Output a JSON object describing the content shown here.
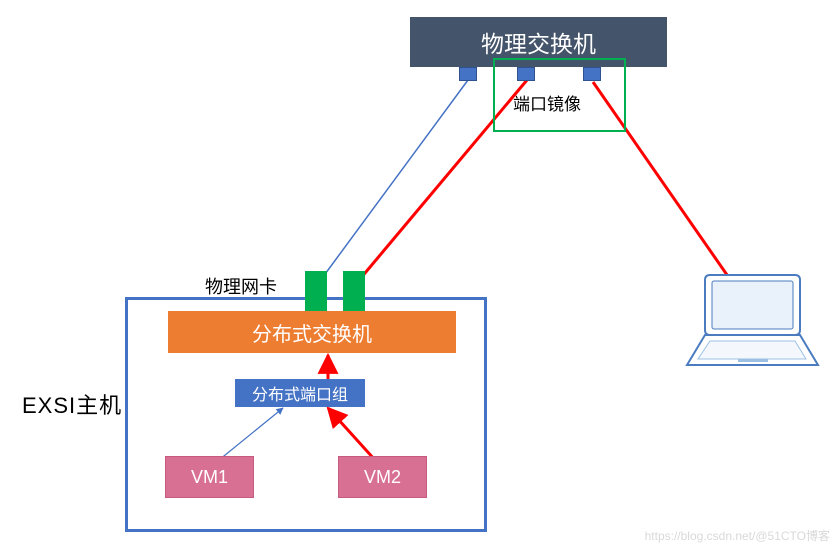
{
  "diagram": {
    "physical_switch_label": "物理交换机",
    "port_mirror_label": "端口镜像",
    "physical_nic_label": "物理网卡",
    "host_label": "EXSI主机",
    "distributed_switch_label": "分布式交换机",
    "distributed_portgroup_label": "分布式端口组",
    "vm1_label": "VM1",
    "vm2_label": "VM2",
    "watermark": "https://blog.csdn.net/@51CTO博客"
  },
  "chart_data": {
    "type": "diagram",
    "title": "",
    "nodes": [
      {
        "id": "phys_switch",
        "label": "物理交换机",
        "role": "physical L2 switch"
      },
      {
        "id": "port_mirror",
        "label": "端口镜像",
        "role": "mirror/span ports on physical switch"
      },
      {
        "id": "laptop",
        "label": "",
        "role": "analysis laptop / capture host"
      },
      {
        "id": "exsi_host",
        "label": "EXSI主机",
        "role": "ESXi host"
      },
      {
        "id": "phys_nic",
        "label": "物理网卡",
        "role": "physical NICs (2 uplinks)"
      },
      {
        "id": "dvs",
        "label": "分布式交换机",
        "role": "distributed virtual switch"
      },
      {
        "id": "dpg",
        "label": "分布式端口组",
        "role": "distributed port group"
      },
      {
        "id": "vm1",
        "label": "VM1",
        "role": "virtual machine"
      },
      {
        "id": "vm2",
        "label": "VM2",
        "role": "virtual machine"
      }
    ],
    "edges": [
      {
        "from": "vm1",
        "to": "dpg",
        "style": "normal",
        "color": "blue"
      },
      {
        "from": "vm2",
        "to": "dpg",
        "style": "mirrored-traffic",
        "color": "red"
      },
      {
        "from": "dpg",
        "to": "dvs",
        "style": "containment",
        "color": "none"
      },
      {
        "from": "dvs",
        "to": "phys_nic",
        "style": "uplink",
        "color": "none"
      },
      {
        "from": "phys_nic",
        "to": "phys_switch",
        "style": "uplink",
        "color": "blue",
        "note": "nic1 normal uplink"
      },
      {
        "from": "phys_nic",
        "to": "port_mirror",
        "style": "mirrored-traffic",
        "color": "red",
        "note": "nic2 carries mirrored VM2 traffic"
      },
      {
        "from": "port_mirror",
        "to": "laptop",
        "style": "mirrored-traffic",
        "color": "red"
      }
    ]
  }
}
